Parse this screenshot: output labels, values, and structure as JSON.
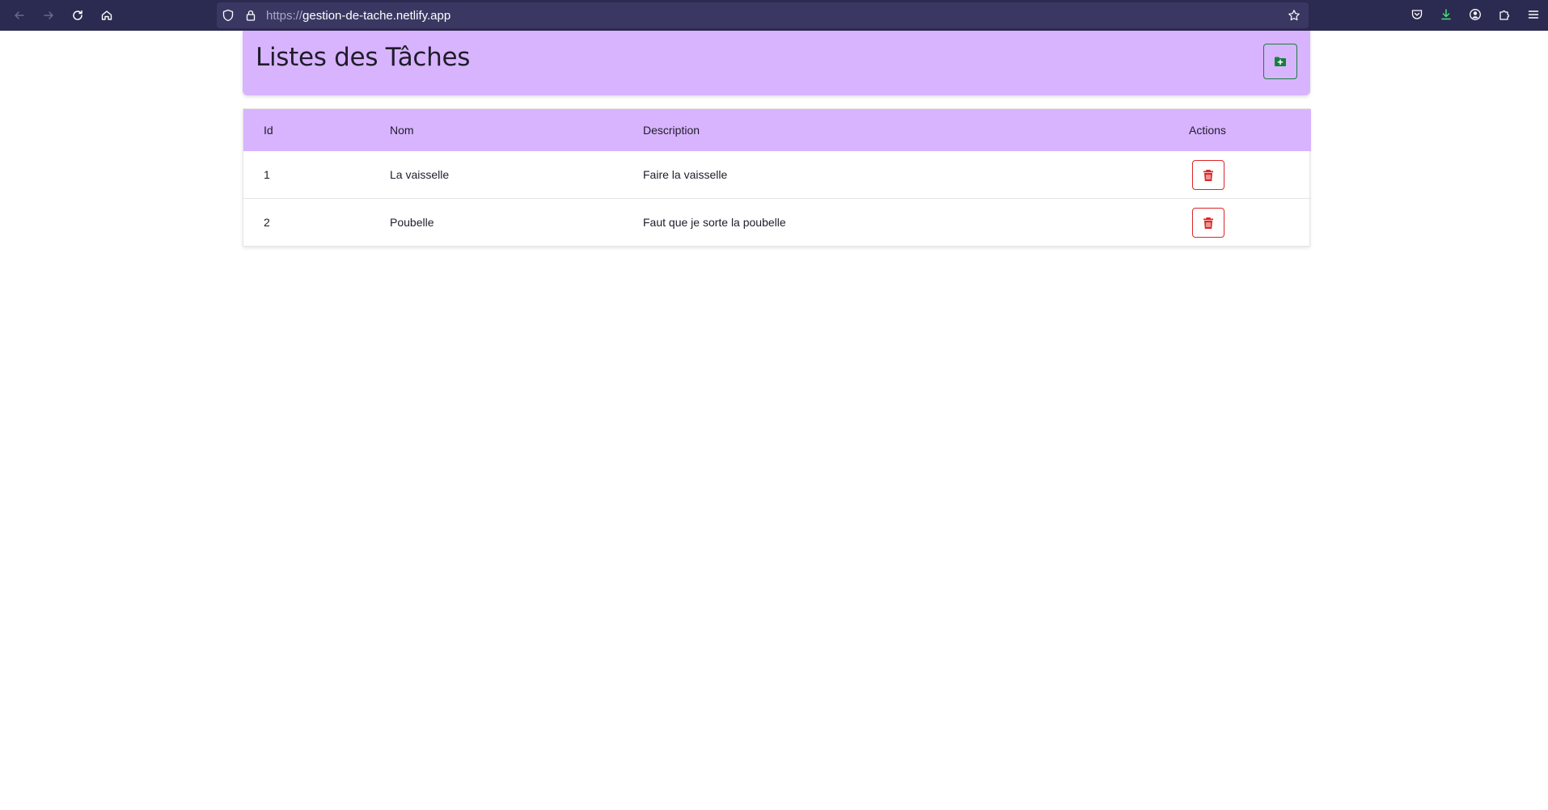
{
  "browser": {
    "url_scheme": "https://",
    "url_host": "gestion-de-tache.netlify.app"
  },
  "header": {
    "title": "Listes des Tâches",
    "add_icon": "folder-plus-icon"
  },
  "table": {
    "columns": {
      "id": "Id",
      "name": "Nom",
      "description": "Description",
      "actions": "Actions"
    },
    "rows": [
      {
        "id": "1",
        "name": "La vaisselle",
        "description": "Faire la vaisselle"
      },
      {
        "id": "2",
        "name": "Poubelle",
        "description": "Faut que je sorte la poubelle"
      }
    ]
  },
  "colors": {
    "accent": "#d8b4fe",
    "toolbar": "#2b2a50",
    "add": "#15803d",
    "delete": "#dc2626"
  }
}
